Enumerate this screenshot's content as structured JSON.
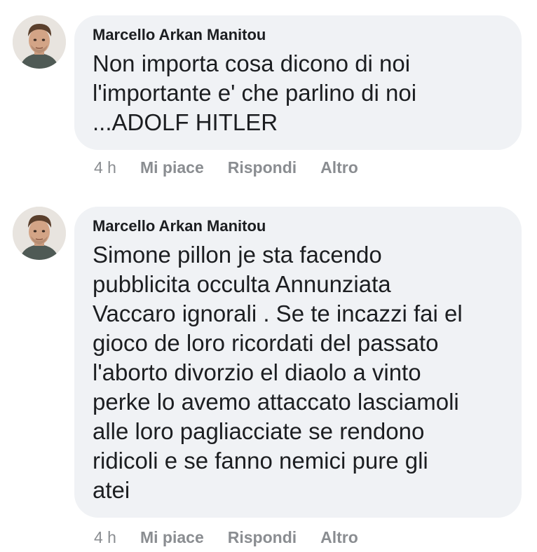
{
  "comments": [
    {
      "author": "Marcello Arkan Manitou",
      "text": "Non importa cosa dicono di noi\nl'importante e' che parlino di noi\n...ADOLF HITLER",
      "time": "4 h",
      "like_label": "Mi piace",
      "reply_label": "Rispondi",
      "more_label": "Altro"
    },
    {
      "author": "Marcello Arkan Manitou",
      "text": "Simone pillon je sta facendo\npubblicita occulta Annunziata\nVaccaro ignorali . Se te incazzi fai el\ngioco de loro ricordati del passato\nl'aborto divorzio el diaolo a vinto\nperke lo avemo attaccato lasciamoli\nalle loro pagliacciate se rendono\nridicoli e se fanno nemici pure gli\natei",
      "time": "4 h",
      "like_label": "Mi piace",
      "reply_label": "Rispondi",
      "more_label": "Altro"
    }
  ],
  "colors": {
    "bubble": "#f0f2f5",
    "text": "#1c1e21",
    "meta": "#8a8d91"
  },
  "icons": {
    "avatar": "profile-photo-avatar"
  }
}
